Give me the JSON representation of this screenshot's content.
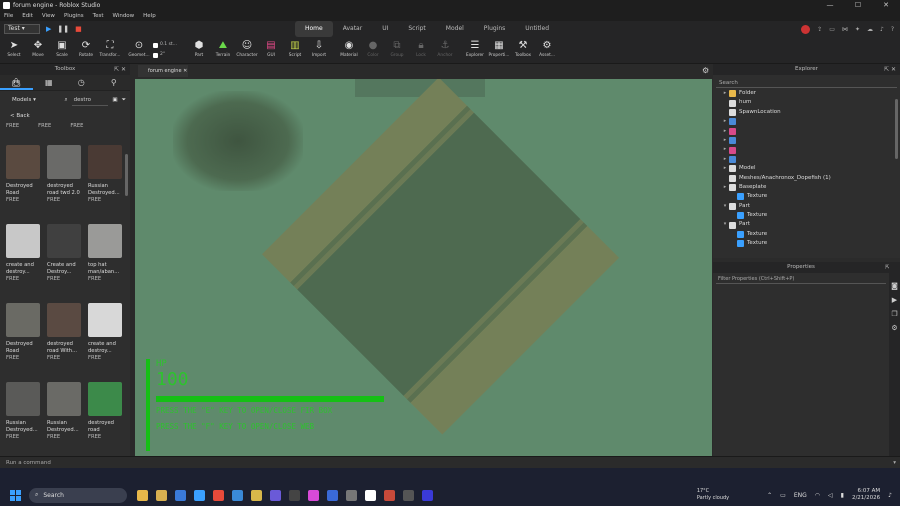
{
  "window": {
    "title": "forum engine - Roblox Studio",
    "controls": [
      "—",
      "☐",
      "✕"
    ]
  },
  "menu": [
    "File",
    "Edit",
    "View",
    "Plugins",
    "Test",
    "Window",
    "Help"
  ],
  "ribbon": {
    "mode": "Test",
    "tabs": [
      "Home",
      "Avatar",
      "UI",
      "Script",
      "Model",
      "Plugins",
      "Untitled"
    ],
    "active_tab": "Home"
  },
  "toolbar": {
    "tools": [
      {
        "label": "Select",
        "icon": "cursor-icon"
      },
      {
        "label": "Move",
        "icon": "move-icon"
      },
      {
        "label": "Scale",
        "icon": "scale-icon"
      },
      {
        "label": "Rotate",
        "icon": "rotate-icon"
      },
      {
        "label": "Transfor...",
        "icon": "transform-icon"
      }
    ],
    "geometry_label": "Geomet...",
    "grid_move": "0.1 st...",
    "grid_rotate": "2°",
    "tools2": [
      {
        "label": "Part",
        "icon": "part-icon"
      },
      {
        "label": "Terrain",
        "icon": "terrain-icon"
      },
      {
        "label": "Character",
        "icon": "character-icon"
      },
      {
        "label": "GUI",
        "icon": "gui-icon"
      },
      {
        "label": "Script",
        "icon": "script-icon"
      },
      {
        "label": "Import",
        "icon": "import-icon"
      },
      {
        "label": "Material",
        "icon": "material-icon"
      },
      {
        "label": "Color",
        "icon": "color-icon"
      },
      {
        "label": "Group",
        "icon": "group-icon"
      },
      {
        "label": "Lock",
        "icon": "lock-icon"
      },
      {
        "label": "Anchor",
        "icon": "anchor-icon"
      },
      {
        "label": "Explorer",
        "icon": "explorer-icon"
      },
      {
        "label": "Properti...",
        "icon": "properties-icon"
      },
      {
        "label": "Toolbox",
        "icon": "toolbox-icon"
      },
      {
        "label": "Asset...",
        "icon": "asset-icon"
      }
    ]
  },
  "toolbox": {
    "title": "Toolbox",
    "category": "Models",
    "search": "destro",
    "back_label": "< Back",
    "top_free": [
      "FREE",
      "FREE",
      "FREE"
    ],
    "items": [
      {
        "name": "Destroyed Road",
        "price": "FREE",
        "color": "#5a4a40"
      },
      {
        "name": "destroyed road twd 2.0",
        "price": "FREE",
        "color": "#6a6a68"
      },
      {
        "name": "Russian Destroyed...",
        "price": "FREE",
        "color": "#4a3a34"
      },
      {
        "name": "create and destroy...",
        "price": "FREE",
        "color": "#c8c8c8"
      },
      {
        "name": "Create and Destroy...",
        "price": "FREE",
        "color": "#404040"
      },
      {
        "name": "top hat man/aban...",
        "price": "FREE",
        "color": "#9a9a98"
      },
      {
        "name": "Destroyed Road",
        "price": "FREE",
        "color": "#6a6a64"
      },
      {
        "name": "destroyed road With...",
        "price": "FREE",
        "color": "#5a4a42"
      },
      {
        "name": "create and destroy...",
        "price": "FREE",
        "color": "#d8d8d8"
      },
      {
        "name": "Russian Destroyed...",
        "price": "FREE",
        "color": "#5a5a58"
      },
      {
        "name": "Russian Destroyed...",
        "price": "FREE",
        "color": "#6a6a66"
      },
      {
        "name": "destroyed road",
        "price": "FREE",
        "color": "#3c8a4a"
      }
    ]
  },
  "viewport": {
    "tab": "forum engine",
    "hud": {
      "hp_label": "HP",
      "hp_value": "100",
      "line1": "PRESS THE \"E\" KEY TO OPEN/CLOSE FIR BOX",
      "line2": "PRESS THE \"F\" KEY TO OPEN/CLOSE WEB"
    }
  },
  "explorer": {
    "title": "Explorer",
    "search_placeholder": "Search",
    "rows": [
      {
        "label": "Folder",
        "indent": 1,
        "arrow": "▸",
        "color": "#e8b84a"
      },
      {
        "label": "hum",
        "indent": 1,
        "arrow": "",
        "color": "#ddd"
      },
      {
        "label": "SpawnLocation",
        "indent": 1,
        "arrow": "",
        "color": "#ddd"
      },
      {
        "label": "",
        "indent": 1,
        "arrow": "▸",
        "color": "#4a8ad8"
      },
      {
        "label": "",
        "indent": 1,
        "arrow": "▸",
        "color": "#d84a8a"
      },
      {
        "label": "",
        "indent": 1,
        "arrow": "▸",
        "color": "#4a8ad8"
      },
      {
        "label": "",
        "indent": 1,
        "arrow": "▸",
        "color": "#d84a8a"
      },
      {
        "label": "",
        "indent": 1,
        "arrow": "▸",
        "color": "#4a8ad8"
      },
      {
        "label": "Model",
        "indent": 1,
        "arrow": "▸",
        "color": "#ddd"
      },
      {
        "label": "Meshes/Anachronox_Dopefish (1)",
        "indent": 1,
        "arrow": "",
        "color": "#ddd"
      },
      {
        "label": "Baseplate",
        "indent": 1,
        "arrow": "▸",
        "color": "#ddd"
      },
      {
        "label": "Texture",
        "indent": 2,
        "arrow": "",
        "color": "#3aa0ff"
      },
      {
        "label": "Part",
        "indent": 1,
        "arrow": "▾",
        "color": "#ddd"
      },
      {
        "label": "Texture",
        "indent": 2,
        "arrow": "",
        "color": "#3aa0ff"
      },
      {
        "label": "Part",
        "indent": 1,
        "arrow": "▾",
        "color": "#ddd"
      },
      {
        "label": "Texture",
        "indent": 2,
        "arrow": "",
        "color": "#3aa0ff"
      },
      {
        "label": "Texture",
        "indent": 2,
        "arrow": "",
        "color": "#3aa0ff"
      }
    ]
  },
  "properties": {
    "title": "Properties",
    "filter_placeholder": "Filter Properties (Ctrl+Shift+P)"
  },
  "command_bar": {
    "placeholder": "Run a command"
  },
  "taskbar": {
    "search_label": "Search",
    "weather_temp": "17°C",
    "weather_text": "Partly cloudy",
    "lang": "ENG",
    "time": "6:07 AM",
    "date": "2/21/2026",
    "apps": [
      "#e8b84a",
      "#d8b050",
      "#3a7ad8",
      "#3aa0ff",
      "#e84a3a",
      "#3a8ad8",
      "#d8b84a",
      "#6a5ad8",
      "#444",
      "#d84ad8",
      "#3a6ad8",
      "#777",
      "#fff",
      "#c84a3a",
      "#555",
      "#3a3ad8"
    ]
  }
}
